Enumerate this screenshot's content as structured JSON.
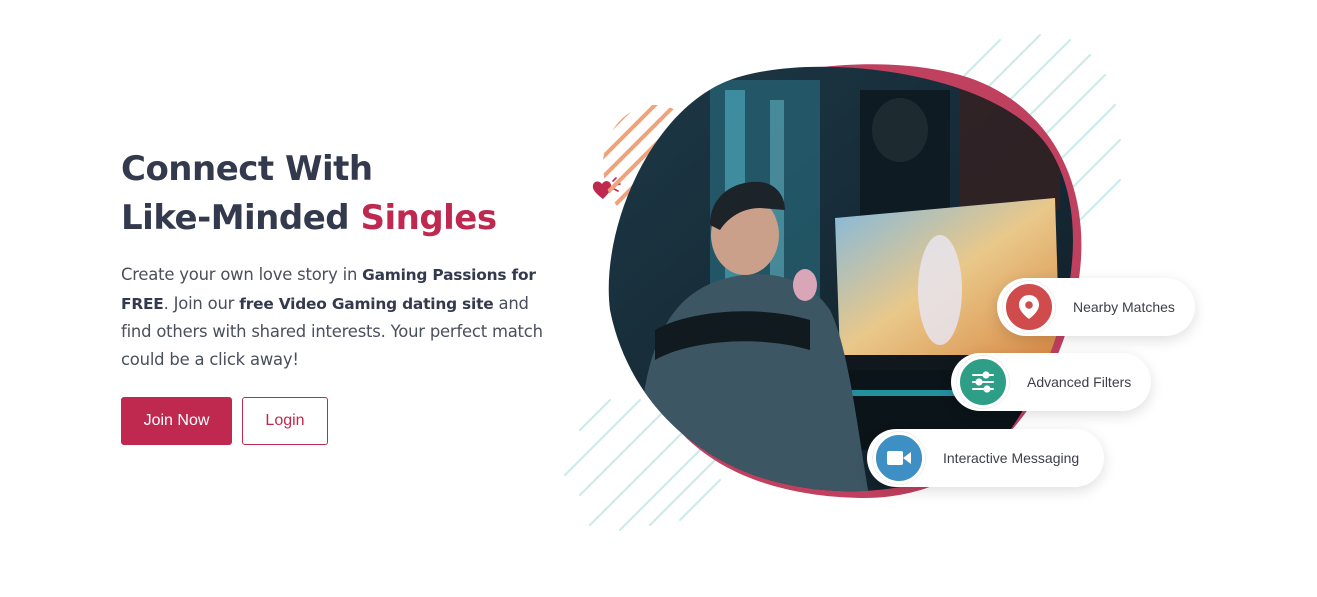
{
  "hero": {
    "headline_line1": "Connect With",
    "headline_line2_prefix": "Like-Minded ",
    "headline_accent": "Singles",
    "description": {
      "part1": "Create your own love story in ",
      "bold1": "Gaming Passions for FREE",
      "part2": ". Join our ",
      "bold2": "free Video Gaming dating site",
      "part3": " and find others with shared interests. Your perfect match could be a click away!"
    }
  },
  "buttons": {
    "join_label": "Join Now",
    "login_label": "Login"
  },
  "features": [
    {
      "label": "Nearby Matches",
      "icon": "map-pin-icon",
      "color": "#d04c4c"
    },
    {
      "label": "Advanced Filters",
      "icon": "sliders-icon",
      "color": "#2f9e86"
    },
    {
      "label": "Interactive Messaging",
      "icon": "video-camera-icon",
      "color": "#3d8fc4"
    }
  ],
  "colors": {
    "accent": "#c0294f",
    "heading": "#333a4d",
    "stripes_orange": "#f0a27a",
    "stripes_teal": "#cdebe9"
  }
}
